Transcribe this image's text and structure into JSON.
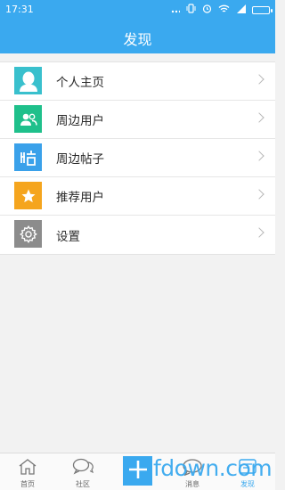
{
  "status_bar": {
    "time": "17:31",
    "icons": [
      "notification-dots-icon",
      "vibrate-icon",
      "alarm-icon",
      "wifi-icon",
      "signal-icon",
      "battery-icon"
    ]
  },
  "header": {
    "title": "发现",
    "color": "#3aa9ef"
  },
  "menu": {
    "items": [
      {
        "label": "个人主页",
        "icon": "person-icon",
        "color": "#39c0cd"
      },
      {
        "label": "周边用户",
        "icon": "users-icon",
        "color": "#1fc08b"
      },
      {
        "label": "周边帖子",
        "icon": "post-icon",
        "color": "#3aa1ea"
      },
      {
        "label": "推荐用户",
        "icon": "star-icon",
        "color": "#f5a51e"
      },
      {
        "label": "设置",
        "icon": "gear-icon",
        "color": "#8c8c8c"
      }
    ]
  },
  "tabbar": {
    "tabs": [
      {
        "label": "首页",
        "icon": "home-icon"
      },
      {
        "label": "社区",
        "icon": "chat-icon"
      },
      {
        "label": "",
        "icon": "plus-icon"
      },
      {
        "label": "消息",
        "icon": "message-icon"
      },
      {
        "label": "发现",
        "icon": "discover-icon",
        "active": true
      }
    ],
    "active_color": "#3aa9ef"
  },
  "watermark": "fdown.com"
}
